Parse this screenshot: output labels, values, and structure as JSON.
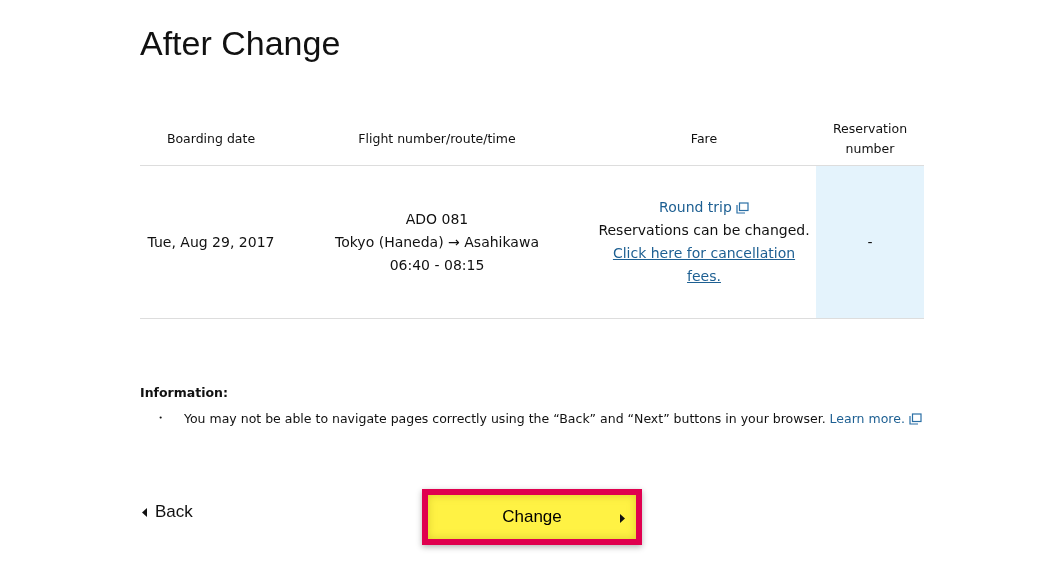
{
  "title": "After Change",
  "table": {
    "columns": [
      "Boarding date",
      "Flight number/route/time",
      "Fare",
      "Reservation number"
    ],
    "rows": [
      {
        "boarding_date": "Tue, Aug 29, 2017",
        "flight": [
          "ADO 081",
          "Tokyo (Haneda) → Asahikawa",
          "06:40 - 08:15"
        ],
        "fare_link": "Round trip",
        "fare_note": "Reservations can be changed.",
        "fare_fees_link": "Click here for cancellation fees.",
        "reservation_number": "-"
      }
    ]
  },
  "information": {
    "heading": "Information:",
    "items": [
      {
        "bullet": "・",
        "text": "You may not be able to navigate pages correctly using the “Back” and “Next” buttons in your browser.",
        "link": "Learn more."
      }
    ]
  },
  "back_button": "Back",
  "change_button": {
    "label": "Change",
    "highlighted": true
  }
}
